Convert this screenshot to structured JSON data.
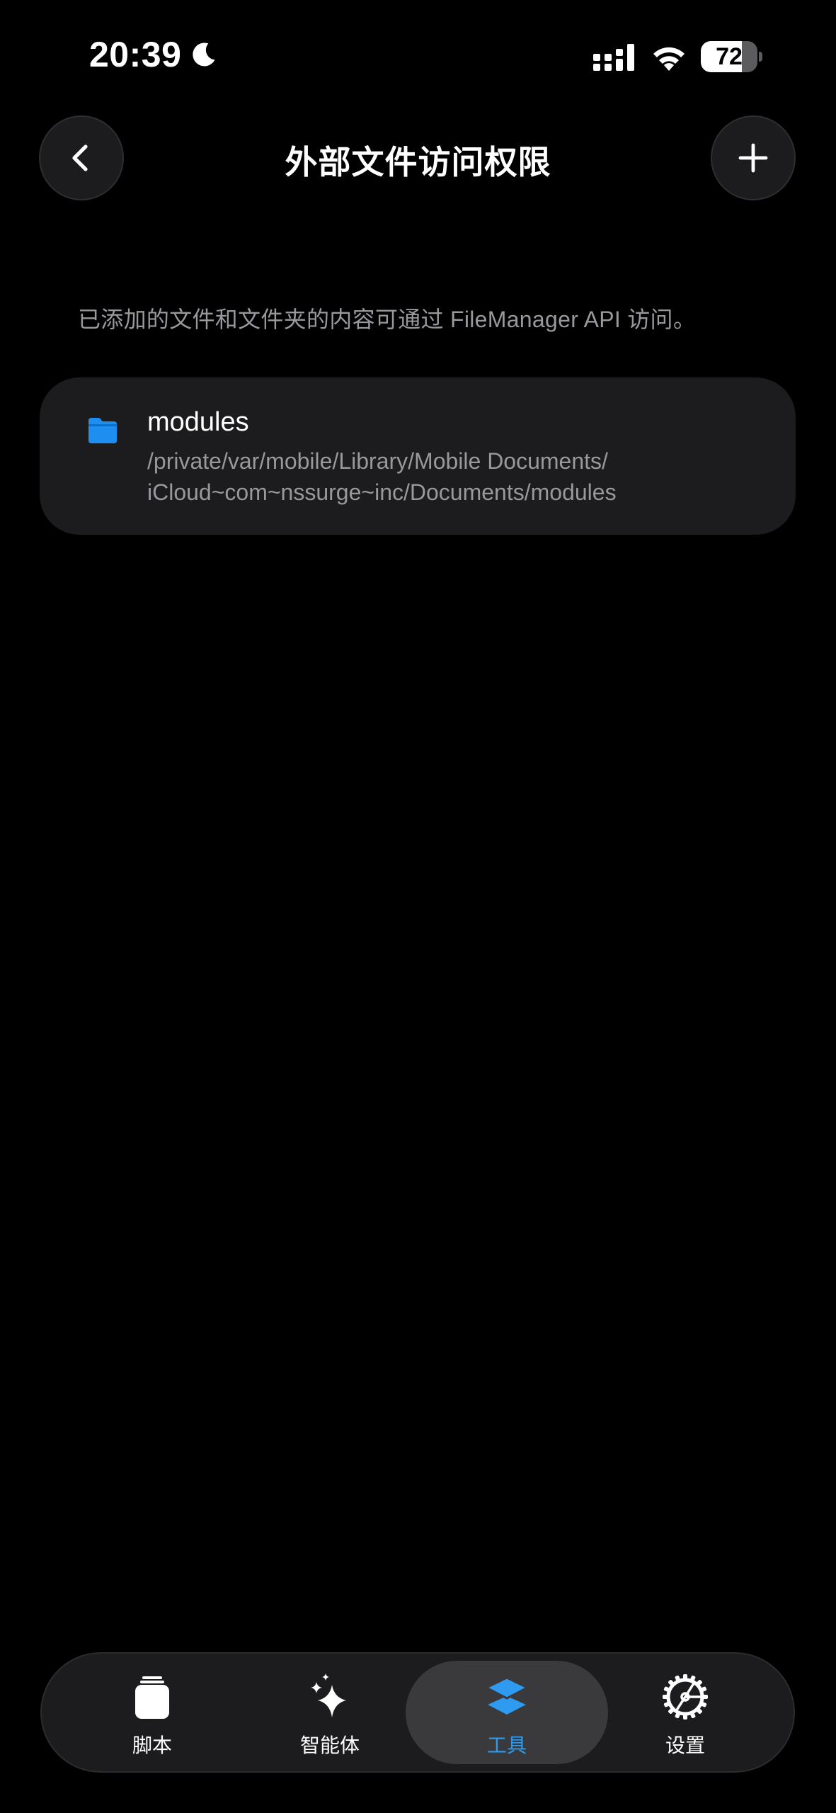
{
  "status_bar": {
    "time": "20:39",
    "battery_level": "72",
    "battery_fraction": 0.72,
    "icons": [
      "moon-icon",
      "signal-icon",
      "wifi-icon",
      "battery-icon"
    ]
  },
  "nav": {
    "title": "外部文件访问权限",
    "back_icon": "chevron-left-icon",
    "add_icon": "plus-icon"
  },
  "description": "已添加的文件和文件夹的内容可通过 FileManager API 访问。",
  "files": [
    {
      "icon": "folder-icon",
      "name": "modules",
      "path_line1": "/private/var/mobile/Library/Mobile Documents/",
      "path_line2": "iCloud~com~nssurge~inc/Documents/modules"
    }
  ],
  "tab_bar": {
    "active": "工具",
    "tabs": [
      {
        "label": "脚本",
        "icon": "jar-icon"
      },
      {
        "label": "智能体",
        "icon": "sparkles-icon"
      },
      {
        "label": "工具",
        "icon": "layers-icon"
      },
      {
        "label": "设置",
        "icon": "gear-icon"
      }
    ]
  },
  "colors": {
    "background": "#000000",
    "card": "#1c1c1e",
    "secondary_text": "#98989d",
    "accent": "#2f9bf0",
    "folder": "#1e8ef0"
  }
}
